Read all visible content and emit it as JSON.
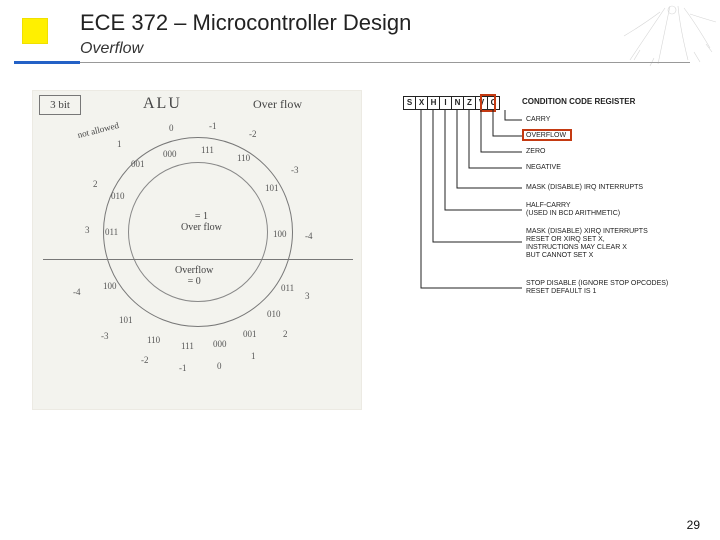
{
  "title": "ECE 372 – Microcontroller Design",
  "subtitle": "Overflow",
  "page_number": "29",
  "sketch": {
    "box_label": "3 bit",
    "alu_label": "ALU",
    "overflow_label": "Over flow",
    "not_allowed": "not allowed",
    "eq1_top": "= 1",
    "eq1_bot": "Over flow",
    "eq0_top": "Overflow",
    "eq0_bot": "= 0",
    "outer_top": [
      "0",
      "-1",
      "-2"
    ],
    "outer_tr": "-3",
    "outer_r": "-4",
    "outer_left_nums": [
      "1",
      "2",
      "3"
    ],
    "outer_bl": "-4",
    "outer_bottom_nums": [
      "-3",
      "-2",
      "-1",
      "0",
      "1",
      "2",
      "3"
    ],
    "inner_bits_top": [
      "000",
      "111",
      "110"
    ],
    "inner_bits_tr": "101",
    "inner_bits_r": "100",
    "inner_bits_left": [
      "001",
      "010",
      "011"
    ],
    "inner_bits_bl": "100",
    "inner_bits_bottom": [
      "101",
      "110",
      "111",
      "000",
      "001",
      "010",
      "011"
    ]
  },
  "ccr": {
    "title": "CONDITION CODE REGISTER",
    "bits": [
      "S",
      "X",
      "H",
      "I",
      "N",
      "Z",
      "V",
      "C"
    ],
    "labels": {
      "carry": "CARRY",
      "overflow": "OVERFLOW",
      "zero": "ZERO",
      "negative": "NEGATIVE",
      "irq": "MASK (DISABLE) IRQ INTERRUPTS",
      "half": "HALF-CARRY\n(USED IN BCD ARITHMETIC)",
      "xirq": "MASK (DISABLE) XIRQ INTERRUPTS\nRESET OR XIRQ SET X,\nINSTRUCTIONS MAY CLEAR X\nBUT CANNOT SET X",
      "stop": "STOP DISABLE (IGNORE STOP OPCODES)\nRESET DEFAULT IS 1"
    }
  }
}
